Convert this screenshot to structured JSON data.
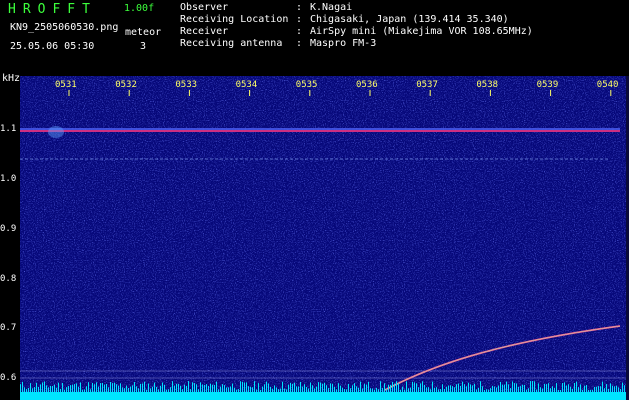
{
  "header": {
    "logo_text": "HROFFT",
    "version": "1.00f",
    "filename": "KN9_2505060530.png",
    "meteor_label": "meteor",
    "timestamp": "25.05.06 05:30",
    "count": "3",
    "info_rows": [
      {
        "key": "Observer",
        "value": "K.Nagai"
      },
      {
        "key": "Receiving Location",
        "value": "Chigasaki, Japan (139.414 35.340)"
      },
      {
        "key": "Receiver",
        "value": "AirSpy mini (Miakejima VOR 108.65MHz)"
      },
      {
        "key": "Receiving antenna",
        "value": "Maspro FM-3"
      }
    ]
  },
  "spectrogram": {
    "y_unit": "kHz",
    "y_ticks": [
      "1.1",
      "1.0",
      "0.9",
      "0.8",
      "0.7",
      "0.6"
    ],
    "x_ticks": [
      "0531",
      "0532",
      "0533",
      "0534",
      "0535",
      "0536",
      "0537",
      "0538",
      "0539",
      "0540"
    ],
    "colors": {
      "background": "#06087a",
      "carrier": "#ff3060",
      "trace": "#ff6090",
      "baseline": "#00e5ff",
      "tick_label": "#ffff66"
    }
  }
}
